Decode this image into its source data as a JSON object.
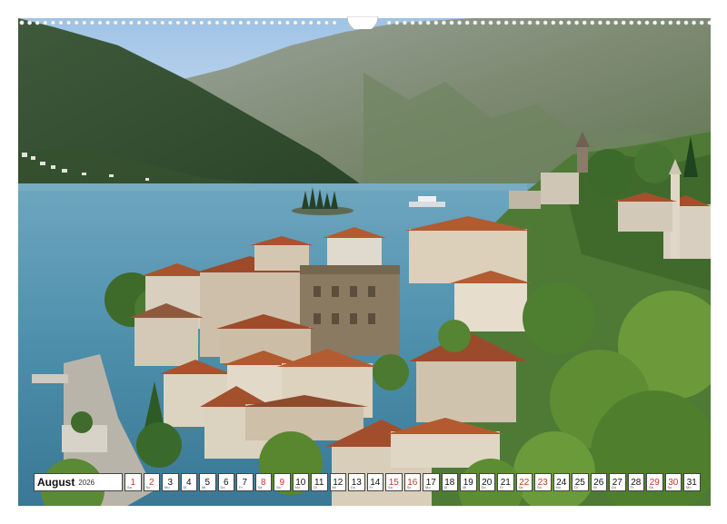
{
  "calendar": {
    "month": "August",
    "year": "2026",
    "weekend_color": "#c0392b",
    "days": [
      {
        "num": "1",
        "abbr": "Sa",
        "weekend": true
      },
      {
        "num": "2",
        "abbr": "So",
        "weekend": true
      },
      {
        "num": "3",
        "abbr": "Mo",
        "weekend": false
      },
      {
        "num": "4",
        "abbr": "Di",
        "weekend": false
      },
      {
        "num": "5",
        "abbr": "Mi",
        "weekend": false
      },
      {
        "num": "6",
        "abbr": "Do",
        "weekend": false
      },
      {
        "num": "7",
        "abbr": "Fr",
        "weekend": false
      },
      {
        "num": "8",
        "abbr": "Sa",
        "weekend": true
      },
      {
        "num": "9",
        "abbr": "So",
        "weekend": true
      },
      {
        "num": "10",
        "abbr": "Mo",
        "weekend": false
      },
      {
        "num": "11",
        "abbr": "Di",
        "weekend": false
      },
      {
        "num": "12",
        "abbr": "Mi",
        "weekend": false
      },
      {
        "num": "13",
        "abbr": "Do",
        "weekend": false
      },
      {
        "num": "14",
        "abbr": "Fr",
        "weekend": false
      },
      {
        "num": "15",
        "abbr": "Sa",
        "weekend": true
      },
      {
        "num": "16",
        "abbr": "So",
        "weekend": true
      },
      {
        "num": "17",
        "abbr": "Mo",
        "weekend": false
      },
      {
        "num": "18",
        "abbr": "Di",
        "weekend": false
      },
      {
        "num": "19",
        "abbr": "Mi",
        "weekend": false
      },
      {
        "num": "20",
        "abbr": "Do",
        "weekend": false
      },
      {
        "num": "21",
        "abbr": "Fr",
        "weekend": false
      },
      {
        "num": "22",
        "abbr": "Sa",
        "weekend": true
      },
      {
        "num": "23",
        "abbr": "So",
        "weekend": true
      },
      {
        "num": "24",
        "abbr": "Mo",
        "weekend": false
      },
      {
        "num": "25",
        "abbr": "Di",
        "weekend": false
      },
      {
        "num": "26",
        "abbr": "Mi",
        "weekend": false
      },
      {
        "num": "27",
        "abbr": "Do",
        "weekend": false
      },
      {
        "num": "28",
        "abbr": "Fr",
        "weekend": false
      },
      {
        "num": "29",
        "abbr": "Sa",
        "weekend": true
      },
      {
        "num": "30",
        "abbr": "So",
        "weekend": true
      },
      {
        "num": "31",
        "abbr": "Mo",
        "weekend": false
      }
    ]
  }
}
